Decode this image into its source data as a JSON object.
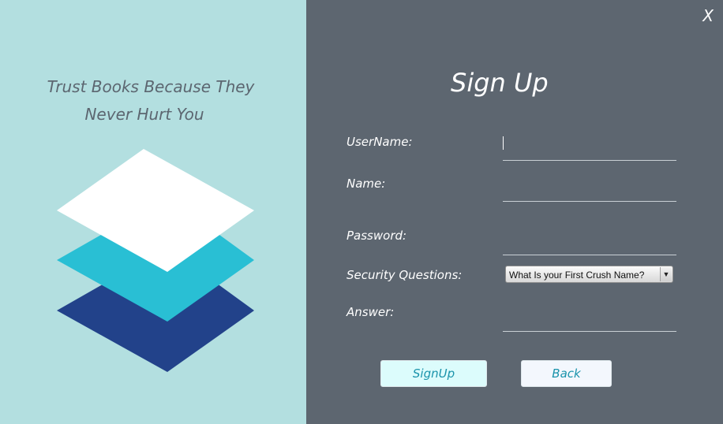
{
  "left": {
    "tagline_line1": "Trust Books Because They",
    "tagline_line2": "Never Hurt You",
    "logo_icon": "stacked-layers-icon",
    "colors": {
      "background": "#b3dfe0",
      "top_layer": "#ffffff",
      "middle_layer": "#29bfd4",
      "bottom_layer": "#22428a"
    }
  },
  "window": {
    "close_label": "X"
  },
  "form": {
    "title": "Sign Up",
    "username_label": "UserName:",
    "username_value": "",
    "name_label": "Name:",
    "name_value": "",
    "password_label": "Password:",
    "password_value": "",
    "security_label": "Security Questions:",
    "security_selected": "What Is your First Crush Name?",
    "answer_label": "Answer:",
    "answer_value": "",
    "signup_label": "SignUp",
    "back_label": "Back",
    "colors": {
      "background": "#5d6670",
      "button_text": "#1a93ab"
    }
  }
}
